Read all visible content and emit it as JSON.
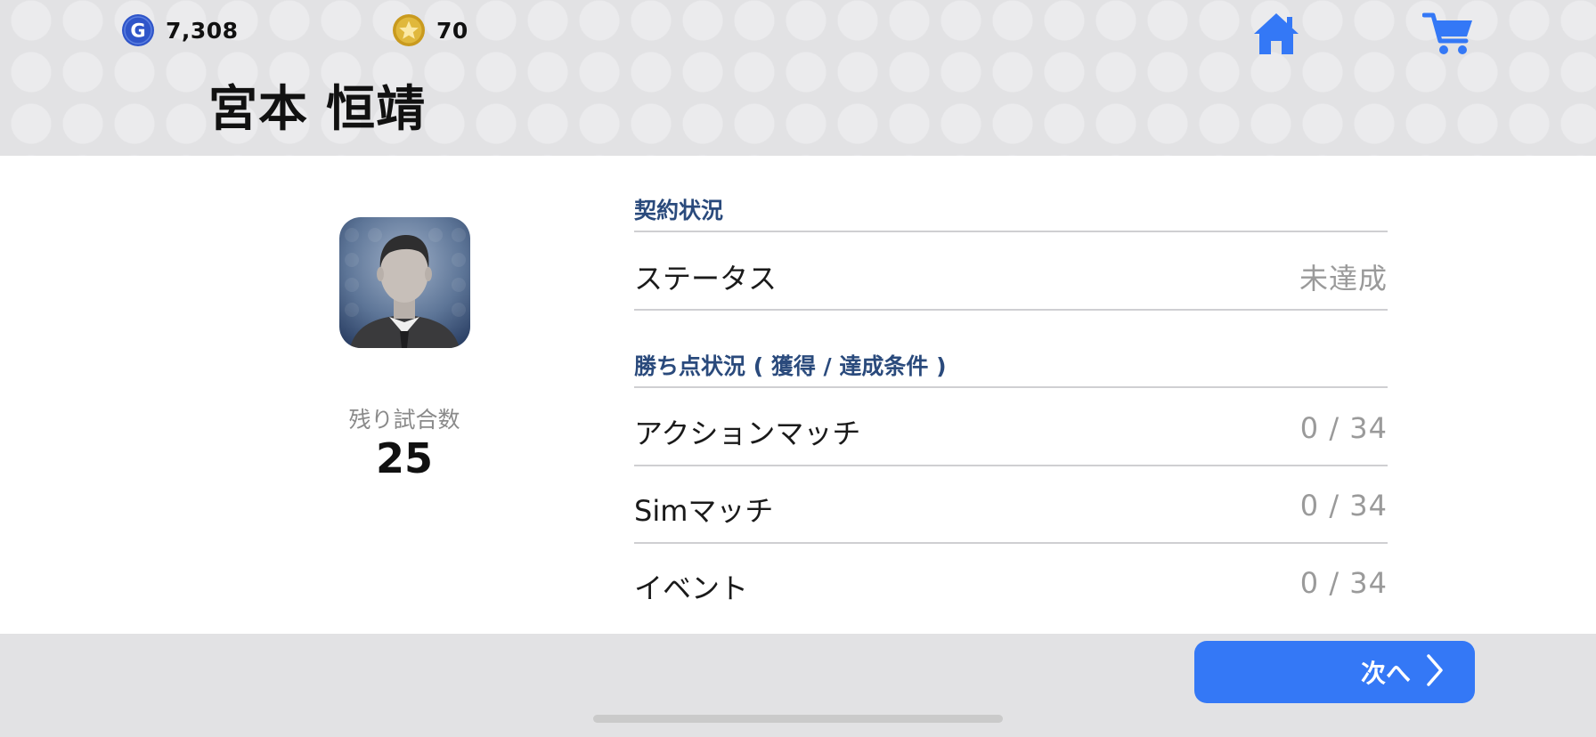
{
  "header": {
    "gp": {
      "icon": "gp-coin-icon",
      "value": "7,308",
      "color": "#2f55c9"
    },
    "coins": {
      "icon": "star-coin-icon",
      "value": "70",
      "color": "#d4aa2e"
    },
    "home_icon": "home-icon",
    "cart_icon": "shopping-cart-icon",
    "manager_name": "宮本 恒靖"
  },
  "profile": {
    "avatar": "manager-silhouette-avatar",
    "remaining_label": "残り試合数",
    "remaining_value": "25"
  },
  "contract": {
    "title": "契約状況",
    "status_label": "ステータス",
    "status_value": "未達成"
  },
  "points": {
    "title": "勝ち点状況 ( 獲得 / 達成条件 )",
    "rows": [
      {
        "label": "アクションマッチ",
        "value": "0 / 34"
      },
      {
        "label": "Simマッチ",
        "value": "0 / 34"
      },
      {
        "label": "イベント",
        "value": "0 / 34"
      }
    ]
  },
  "footer": {
    "next_label": "次へ",
    "next_icon": "chevron-right-icon"
  },
  "colors": {
    "accent": "#3478f6",
    "section_title": "#2a4a7c",
    "header_bg": "#e2e2e4"
  }
}
